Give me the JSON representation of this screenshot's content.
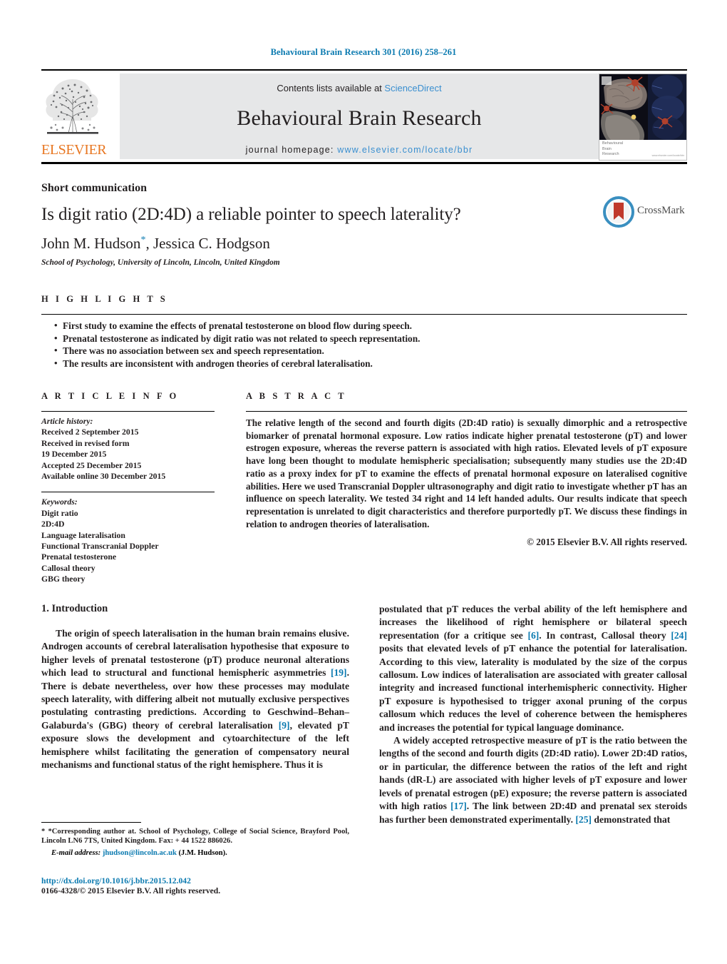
{
  "running_head": "Behavioural Brain Research 301 (2016) 258–261",
  "masthead": {
    "contents_prefix": "Contents lists available at ",
    "sciencedirect": "ScienceDirect",
    "journal_title": "Behavioural Brain Research",
    "homepage_prefix": "journal homepage: ",
    "homepage_url": "www.elsevier.com/locate/bbr",
    "publisher": "ELSEVIER",
    "cover_caption_line1": "Behavioural",
    "cover_caption_line2": "Brain",
    "cover_caption_line3": "Research",
    "cover_caption_small": "www.elsevier.com/locate/bbr"
  },
  "article": {
    "doc_type": "Short communication",
    "title": "Is digit ratio (2D:4D) a reliable pointer to speech laterality?",
    "authors": "John M. Hudson",
    "corresponding_marker": "*",
    "authors_rest": ", Jessica C. Hodgson",
    "affiliation": "School of Psychology, University of Lincoln, Lincoln, United Kingdom",
    "crossmark_label": "CrossMark"
  },
  "highlights": {
    "label": "H I G H L I G H T S",
    "items": [
      "First study to examine the effects of prenatal testosterone on blood flow during speech.",
      "Prenatal testosterone as indicated by digit ratio was not related to speech representation.",
      "There was no association between sex and speech representation.",
      "The results are inconsistent with androgen theories of cerebral lateralisation."
    ]
  },
  "article_info": {
    "label": "A R T I C L E    I N F O",
    "history_head": "Article history:",
    "history": [
      "Received 2 September 2015",
      "Received in revised form",
      "19 December 2015",
      "Accepted 25 December 2015",
      "Available online 30 December 2015"
    ],
    "keywords_head": "Keywords:",
    "keywords": [
      "Digit ratio",
      "2D:4D",
      "Language lateralisation",
      "Functional Transcranial Doppler",
      "Prenatal testosterone",
      "Callosal theory",
      "GBG theory"
    ]
  },
  "abstract": {
    "label": "A B S T R A C T",
    "text": "The relative length of the second and fourth digits (2D:4D ratio) is sexually dimorphic and a retrospective biomarker of prenatal hormonal exposure. Low ratios indicate higher prenatal testosterone (pT) and lower estrogen exposure, whereas the reverse pattern is associated with high ratios. Elevated levels of pT exposure have long been thought to modulate hemispheric specialisation; subsequently many studies use the 2D:4D ratio as a proxy index for pT to examine the effects of prenatal hormonal exposure on lateralised cognitive abilities. Here we used Transcranial Doppler ultrasonography and digit ratio to investigate whether pT has an influence on speech laterality. We tested 34 right and 14 left handed adults. Our results indicate that speech representation is unrelated to digit characteristics and therefore purportedly pT. We discuss these findings in relation to androgen theories of lateralisation.",
    "copyright": "© 2015 Elsevier B.V. All rights reserved."
  },
  "introduction": {
    "heading": "1. Introduction",
    "left_p1_a": "The origin of speech lateralisation in the human brain remains elusive. Androgen accounts of cerebral lateralisation hypothesise that exposure to higher levels of prenatal testosterone (pT) produce neuronal alterations which lead to structural and functional hemispheric asymmetries ",
    "left_ref_19": "[19]",
    "left_p1_b": ". There is debate nevertheless, over how these processes may modulate speech laterality, with differing albeit not mutually exclusive perspectives postulating contrasting predictions. According to Geschwind–Behan–Galaburda's (GBG) theory of cerebral lateralisation ",
    "left_ref_9": "[9]",
    "left_p1_c": ", elevated pT exposure slows the development and cytoarchitecture of the left hemisphere whilst facilitating the generation of compensatory neural mechanisms and functional status of the right hemisphere. Thus it is ",
    "right_p1_a": "postulated that pT reduces the verbal ability of the left hemisphere and increases the likelihood of right hemisphere or bilateral speech representation (for a critique see ",
    "right_ref_6": "[6]",
    "right_p1_b": ". In contrast, Callosal theory ",
    "right_ref_24": "[24]",
    "right_p1_c": " posits that elevated levels of pT enhance the potential for lateralisation. According to this view, laterality is modulated by the size of the corpus callosum. Low indices of lateralisation are associated with greater callosal integrity and increased functional interhemispheric connectivity. Higher pT exposure is hypothesised to trigger axonal pruning of the corpus callosum which reduces the level of coherence between the hemispheres and increases the potential for typical language dominance.",
    "right_p2_a": "A widely accepted retrospective measure of pT is the ratio between the lengths of the second and fourth digits (2D:4D ratio). Lower 2D:4D ratios, or in particular, the difference between the ratios of the left and right hands (dR-L) are associated with higher levels of pT exposure and lower levels of prenatal estrogen (pE) exposure; the reverse pattern is associated with high ratios ",
    "right_ref_17": "[17]",
    "right_p2_b": ". The link between 2D:4D and prenatal sex steroids has further been demonstrated experimentally. ",
    "right_ref_25": "[25]",
    "right_p2_c": " demonstrated that"
  },
  "footnote": {
    "star": "*",
    "text": "*Corresponding author at. School of Psychology, College of Social Science, Brayford Pool, Lincoln LN6 7TS, United Kingdom. Fax: + 44 1522 886026.",
    "email_label": "E-mail address:",
    "email": "jhudson@lincoln.ac.uk",
    "email_suffix": "(J.M. Hudson)."
  },
  "footer": {
    "doi": "http://dx.doi.org/10.1016/j.bbr.2015.12.042",
    "issn": "0166-4328/© 2015 Elsevier B.V. All rights reserved."
  },
  "colors": {
    "link_blue": "#0b7ab0",
    "sd_blue": "#3a8fd0",
    "elsevier_orange": "#e87722",
    "masthead_gray": "#e6e7e8"
  }
}
